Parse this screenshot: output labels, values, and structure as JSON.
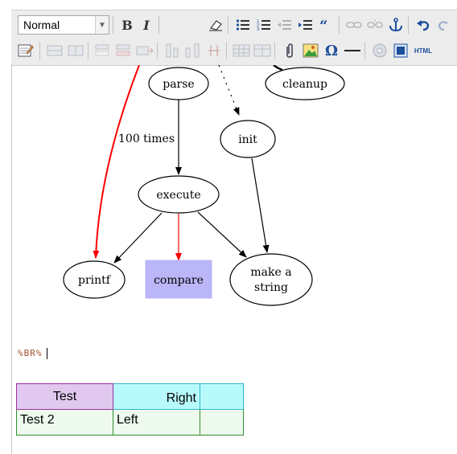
{
  "toolbar": {
    "format_select": "Normal",
    "row1_buttons": [
      "bold-icon",
      "italic-icon",
      "remove-format-icon",
      "bulleted-list-icon",
      "numbered-list-icon",
      "outdent-icon",
      "indent-icon",
      "blockquote-icon",
      "link-icon",
      "unlink-icon",
      "anchor-icon",
      "undo-icon",
      "redo-icon"
    ],
    "row2_buttons": [
      "edit-table-icon",
      "row-icon",
      "merge-cells-icon",
      "insert-row-icon",
      "delete-row-icon",
      "insert-column-icon",
      "delete-column-icon",
      "split-cell-icon",
      "table-icon",
      "table-properties-icon",
      "attachment-icon",
      "image-icon",
      "special-char-icon",
      "horizontal-rule-icon",
      "media-icon",
      "html-source-icon"
    ],
    "bold": "B",
    "italic": "I",
    "omega": "Ω",
    "html_label": "HTML"
  },
  "diagram": {
    "nodes": {
      "parse": "parse",
      "cleanup": "cleanup",
      "init": "init",
      "execute": "execute",
      "printf": "printf",
      "compare": "compare",
      "make_string_line1": "make a",
      "make_string_line2": "string"
    },
    "edge_label": "100 times"
  },
  "content": {
    "br_marker": "%BR%"
  },
  "table": {
    "rows": [
      [
        "Test",
        "Right",
        ""
      ],
      [
        "Test 2",
        "Left",
        ""
      ]
    ],
    "colors": {
      "header_purple": "#e0c8ee",
      "header_cyan": "#b8fafc",
      "body_green": "#eefaee",
      "border_purple": "#9c2f9c",
      "border_cyan": "#2fb8c8",
      "border_green": "#2f8f2f"
    }
  }
}
